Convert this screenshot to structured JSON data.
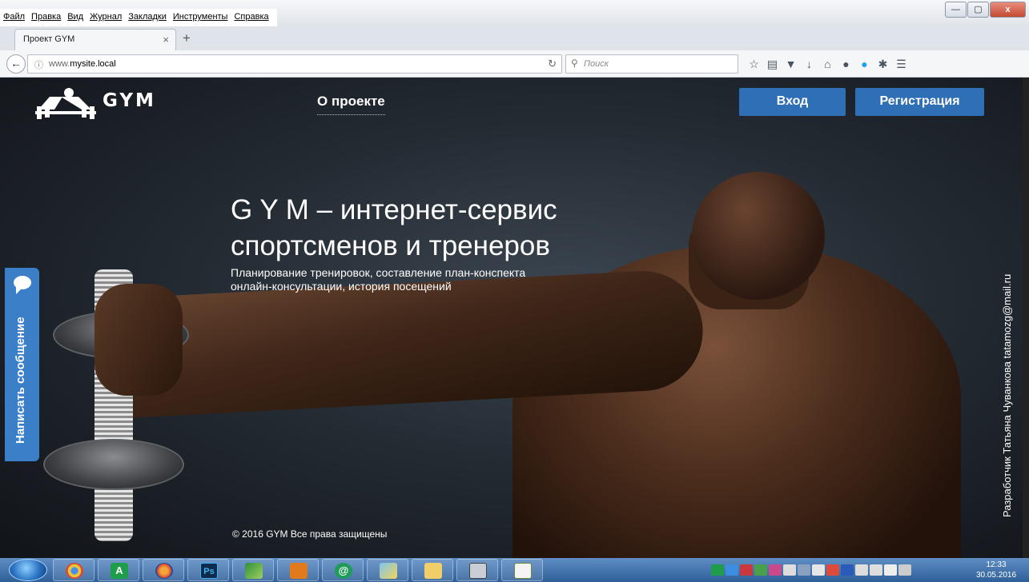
{
  "browser": {
    "menu": [
      "Файл",
      "Правка",
      "Вид",
      "Журнал",
      "Закладки",
      "Инструменты",
      "Справка"
    ],
    "tab_title": "Проект GYM",
    "tab_close": "×",
    "new_tab": "+",
    "url_host": "www.mysite.local",
    "url_prefix": "www.",
    "url_domain": "mysite.local",
    "search_placeholder": "Поиск",
    "toolbar_icons": [
      "star-icon",
      "reading-list-icon",
      "pocket-icon",
      "download-icon",
      "home-icon",
      "chat-icon",
      "skype-icon",
      "addon-icon",
      "menu-icon"
    ],
    "window_buttons": {
      "min": "—",
      "max": "▢",
      "close": "x"
    }
  },
  "site": {
    "logo_text": "GYM",
    "nav_about": "О проекте",
    "login": "Вход",
    "register": "Регистрация",
    "hero_title_lines": [
      "G Y M – интернет-сервис",
      "спортсменов и тренеров"
    ],
    "hero_subtitle_lines": [
      "Планирование тренировок, составление план-конспекта",
      "онлайн-консультации, история посещений"
    ],
    "feedback_label": "Написать сообщение",
    "developer_credit": "Разработчик Татьяна Чуванкова tatamozg@mail.ru",
    "copyright": "© 2016 GYM  Все права защищены",
    "accent_color": "#2f6fb5"
  },
  "taskbar": {
    "apps": [
      "chrome-icon",
      "text-editor-icon",
      "firefox-icon",
      "photoshop-icon",
      "corel-icon",
      "media-player-icon",
      "mail-agent-icon",
      "paint-icon",
      "explorer-icon",
      "calculator-icon",
      "notepad-icon"
    ],
    "app_labels": {
      "editor": "A",
      "photoshop": "Ps",
      "mail": "@"
    },
    "time": "12:33",
    "date": "30.05.2016"
  }
}
